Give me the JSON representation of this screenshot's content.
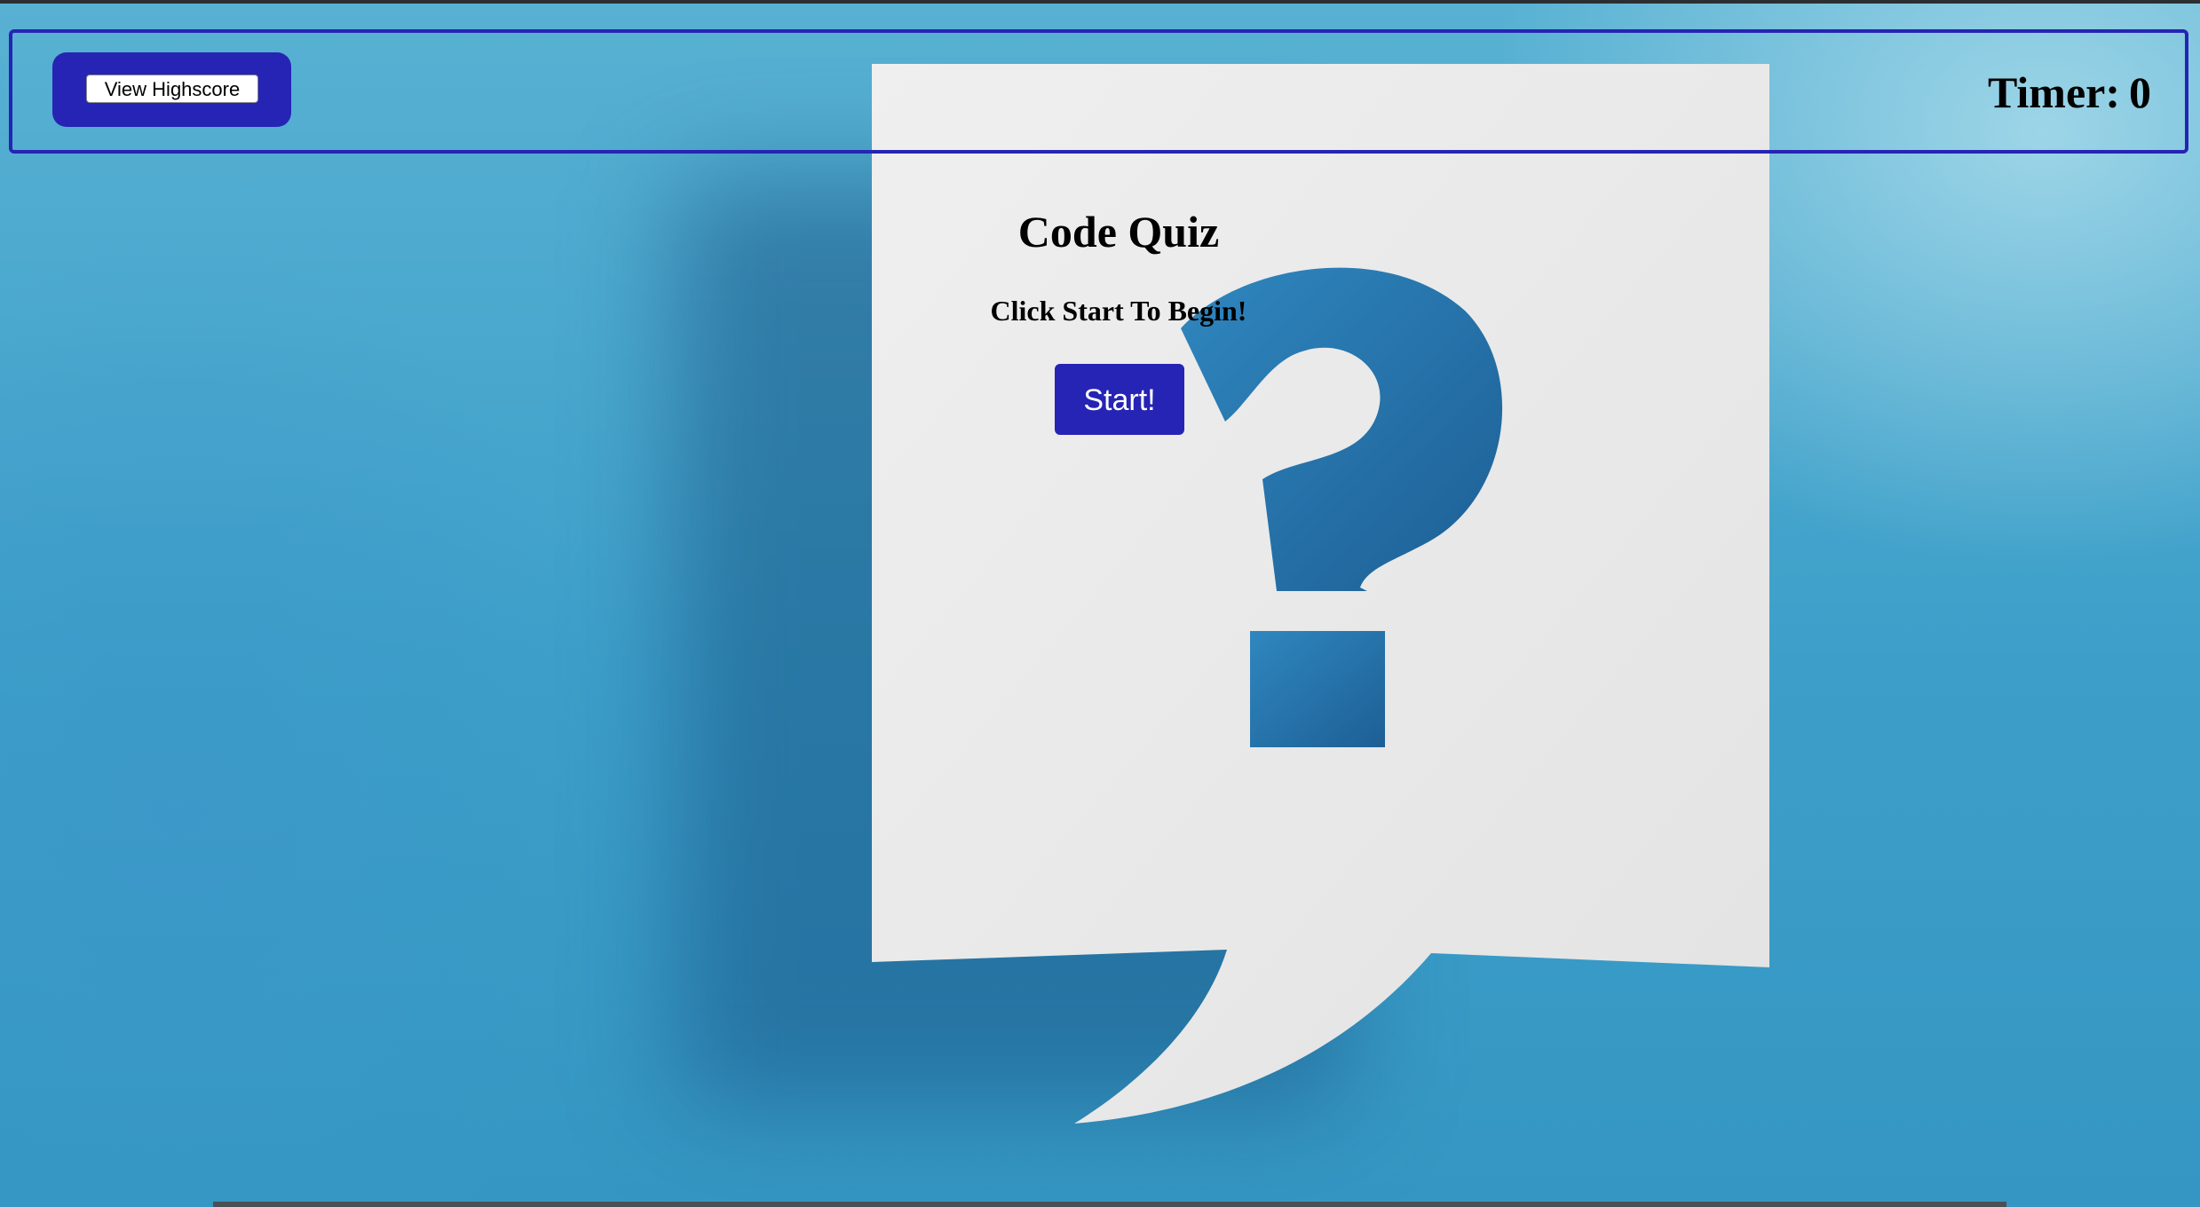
{
  "header": {
    "highscore_label": "View Highscore",
    "timer_label": "Timer:",
    "timer_value": "0"
  },
  "main": {
    "title": "Code Quiz",
    "subtitle": "Click Start To Begin!",
    "start_label": "Start!"
  },
  "colors": {
    "accent": "#2624b4",
    "background": "#3aa0c8",
    "paper": "#ececec"
  },
  "icons": {
    "background_graphic": "question-mark-speech-bubble"
  }
}
